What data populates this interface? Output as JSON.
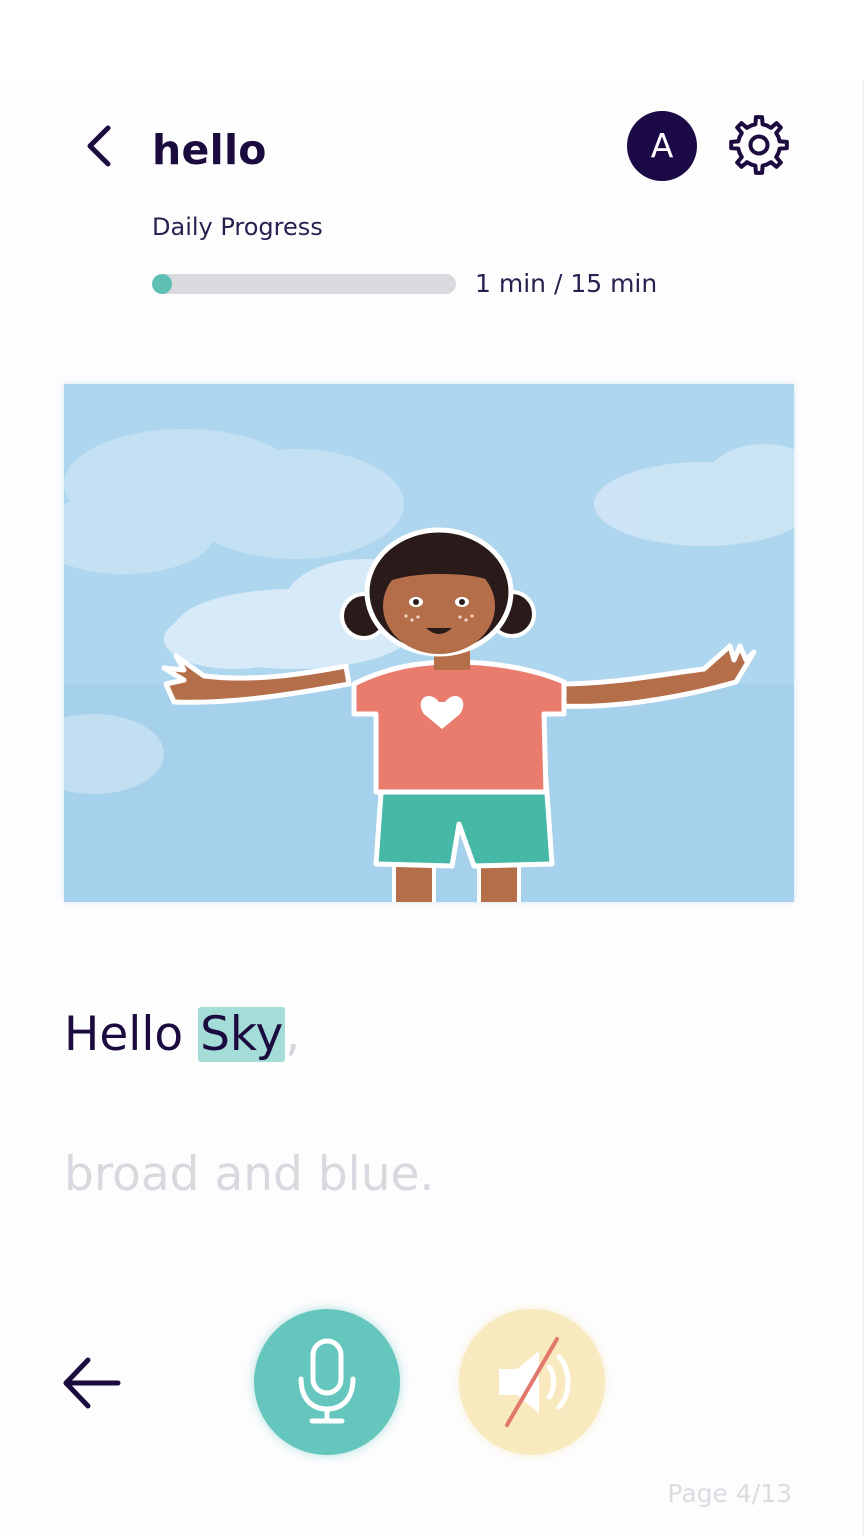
{
  "header": {
    "title": "hello",
    "avatar_initial": "A",
    "icons": {
      "back": "chevron-left-icon",
      "settings": "gear-icon"
    }
  },
  "progress": {
    "label": "Daily Progress",
    "text": "1 min / 15 min",
    "fraction": 0.0667,
    "fill_color": "#5ec0b5",
    "track_color": "#d9dade"
  },
  "illustration": {
    "icon": "girl-waving-sky-illustration",
    "sky_color": "#a9d5ef"
  },
  "reading": {
    "line1": {
      "word1": "Hello",
      "highlighted_word": "Sky",
      "punctuation": ","
    },
    "line2": "broad and blue.",
    "highlight_color": "#a4dcd7"
  },
  "controls": {
    "prev_icon": "arrow-left-icon",
    "mic_icon": "microphone-icon",
    "sound_icon": "speaker-muted-icon",
    "mic_color": "#65c6bd",
    "sound_color": "#f9e9be"
  },
  "page": {
    "indicator": "Page 4/13"
  },
  "colors": {
    "primary_text": "#1b0b3f",
    "avatar_bg": "#1c0a47"
  }
}
